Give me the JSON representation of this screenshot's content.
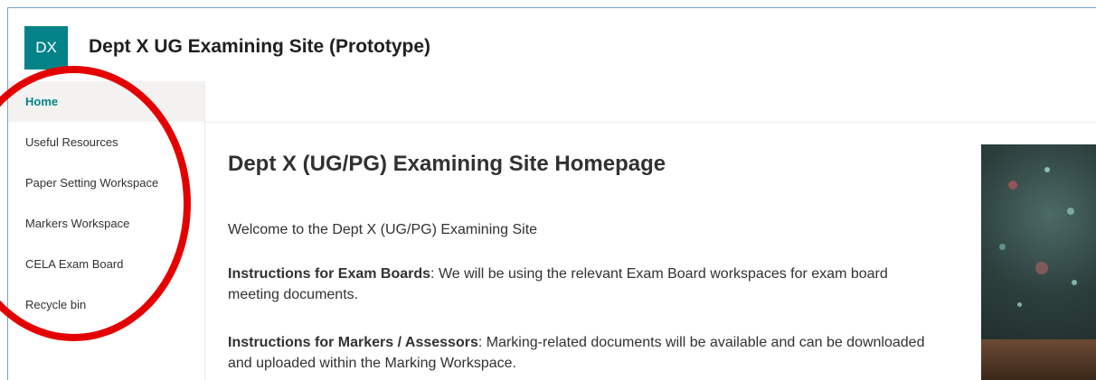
{
  "site": {
    "logo_initials": "DX",
    "title": "Dept X UG Examining Site (Prototype)",
    "brand_color": "#038387"
  },
  "nav": {
    "items": [
      {
        "label": "Home",
        "active": true
      },
      {
        "label": "Useful Resources",
        "active": false
      },
      {
        "label": "Paper Setting Workspace",
        "active": false
      },
      {
        "label": "Markers Workspace",
        "active": false
      },
      {
        "label": "CELA Exam Board",
        "active": false
      },
      {
        "label": "Recycle bin",
        "active": false
      }
    ]
  },
  "main": {
    "heading": "Dept X (UG/PG) Examining Site Homepage",
    "welcome": "Welcome to the Dept X (UG/PG) Examining Site",
    "exam_boards": {
      "label": "Instructions for Exam Boards",
      "text": ": We will be using the relevant Exam Board workspaces for exam board meeting documents."
    },
    "markers": {
      "label": "Instructions for Markers / Assessors",
      "text": ": Marking-related documents will be available and can be downloaded and uploaded within the Marking Workspace."
    }
  },
  "annotation": {
    "color": "#e40000"
  }
}
